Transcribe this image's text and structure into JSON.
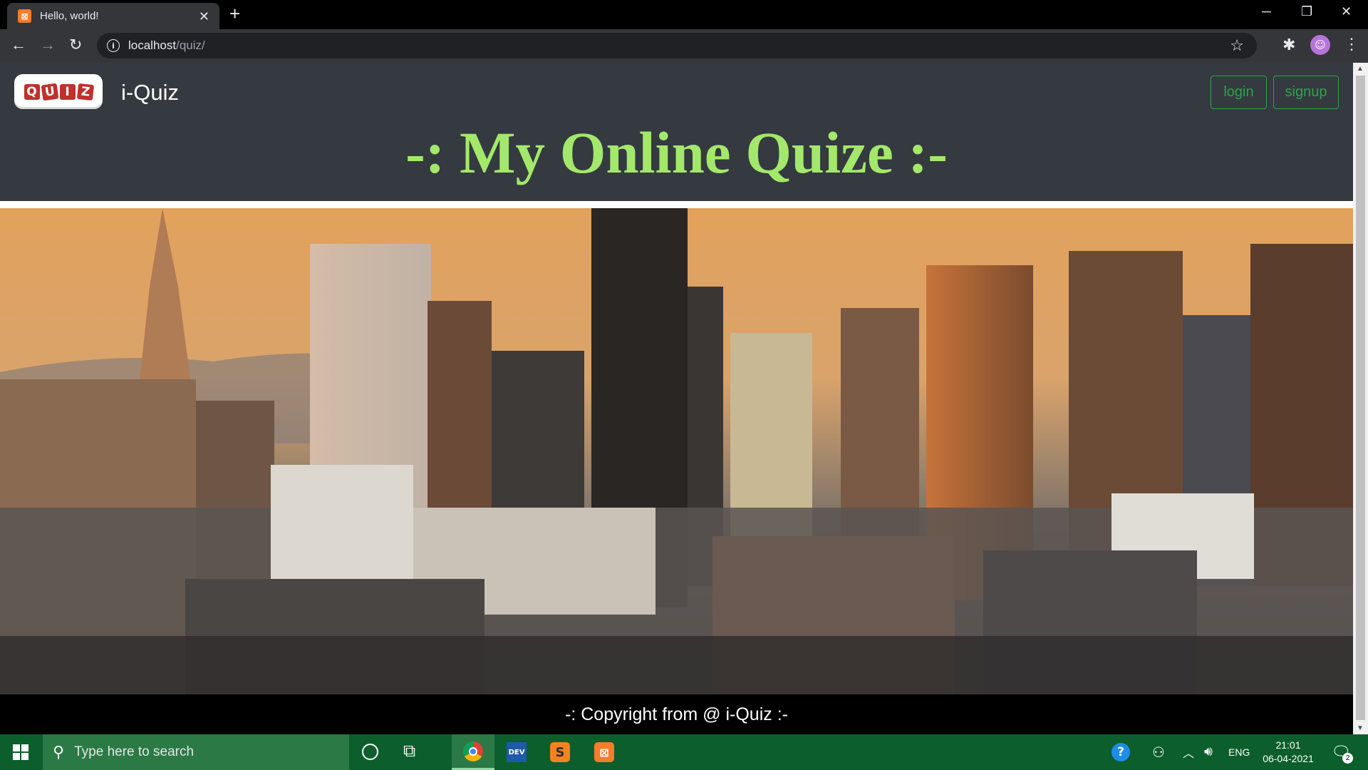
{
  "browser": {
    "tab_title": "Hello, world!",
    "tab_close": "✕",
    "new_tab": "+",
    "url_host": "localhost",
    "url_path": "/quiz/",
    "window_controls": [
      "─",
      "❐",
      "✕"
    ]
  },
  "navbar": {
    "logo_letters": [
      "Q",
      "U",
      "I",
      "Z"
    ],
    "brand": "i-Quiz",
    "login_label": "login",
    "signup_label": "signup"
  },
  "hero": {
    "heading": "-: My Online Quize :-"
  },
  "footer": {
    "text": "-: Copyright from @ i-Quiz :-"
  },
  "taskbar": {
    "search_placeholder": "Type here to search",
    "dev_icon_label": "DEV",
    "help_label": "?",
    "language": "ENG",
    "time": "21:01",
    "date": "06-04-2021",
    "notification_count": "2"
  },
  "colors": {
    "navbar_bg": "#343a40",
    "heading": "#a3e86b",
    "button_outline": "#28a745",
    "taskbar": "#0c5e2c"
  }
}
